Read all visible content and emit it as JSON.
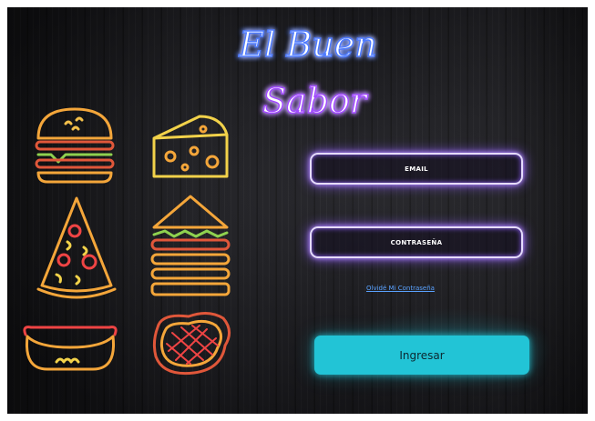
{
  "brand": {
    "line1": "El Buen",
    "line2": "Sabor"
  },
  "decorations": [
    "burger-icon",
    "cheese-icon",
    "pizza-slice-icon",
    "sandwich-icon",
    "hotdog-icon",
    "steak-icon"
  ],
  "login": {
    "email_placeholder": "EMAIL",
    "password_placeholder": "CONTRASEÑA",
    "forgot_link": "Olvidé Mi Contraseña",
    "submit_label": "Ingresar"
  },
  "colors": {
    "neon_purple": "#8b5cf6",
    "neon_blue": "#3b82f6",
    "button_cyan": "#22c4d6",
    "neon_orange": "#f59e0b",
    "neon_red": "#ef4444"
  }
}
